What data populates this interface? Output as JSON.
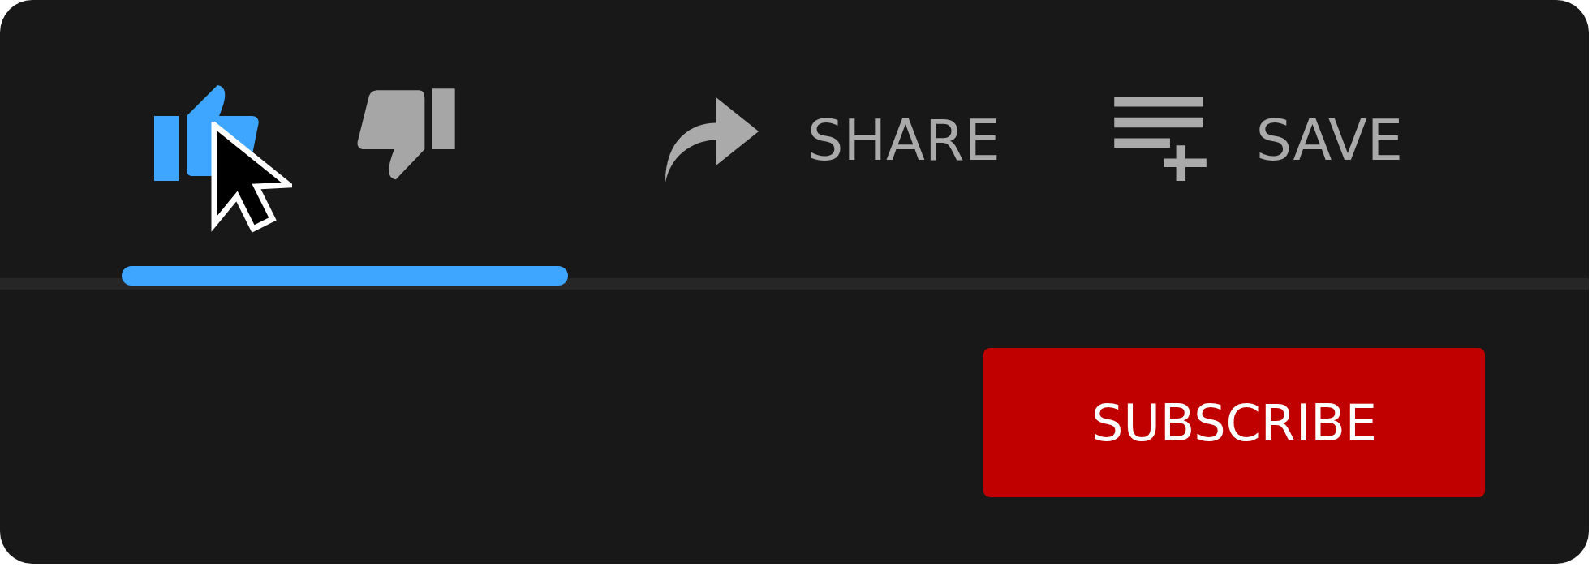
{
  "actions": [
    {
      "kind": "like",
      "selected": true
    },
    {
      "kind": "dislike",
      "selected": false
    },
    {
      "kind": "share",
      "label": "SHARE"
    },
    {
      "kind": "save",
      "label": "SAVE"
    }
  ],
  "subscribe": {
    "label": "SUBSCRIBE"
  }
}
